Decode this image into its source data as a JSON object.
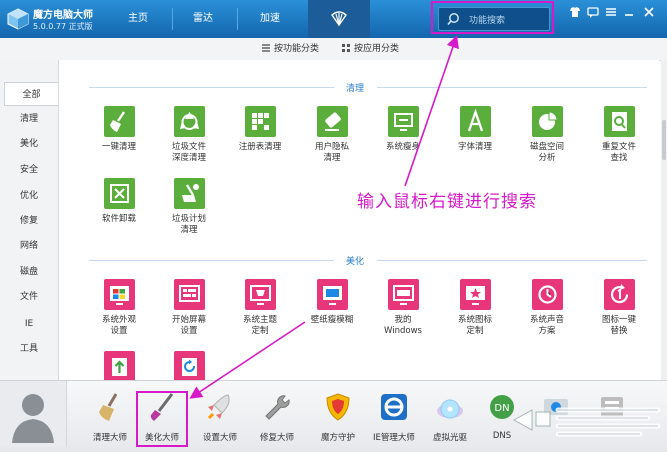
{
  "app": {
    "name": "魔方电脑大师",
    "version": "5.0.0.77 正式版"
  },
  "nav": {
    "tabs": [
      {
        "label": "主页"
      },
      {
        "label": "雷达"
      },
      {
        "label": "加速"
      }
    ]
  },
  "search": {
    "placeholder": "功能搜索"
  },
  "subnav": {
    "tabs": [
      {
        "label": "按功能分类",
        "active": true
      },
      {
        "label": "按应用分类",
        "active": false
      }
    ]
  },
  "sidebar": {
    "items": [
      {
        "label": "全部",
        "active": true
      },
      {
        "label": "清理"
      },
      {
        "label": "美化"
      },
      {
        "label": "安全"
      },
      {
        "label": "优化"
      },
      {
        "label": "修复"
      },
      {
        "label": "网络"
      },
      {
        "label": "磁盘"
      },
      {
        "label": "文件"
      },
      {
        "label": "IE"
      },
      {
        "label": "工具"
      }
    ]
  },
  "sections": [
    {
      "title": "清理",
      "items": [
        {
          "label": "一键清理",
          "icon": "broom-icon"
        },
        {
          "label": "垃圾文件\n深度清理",
          "icon": "recycle-icon"
        },
        {
          "label": "注册表清理",
          "icon": "registry-grid-icon"
        },
        {
          "label": "用户隐私\n清理",
          "icon": "privacy-eraser-icon"
        },
        {
          "label": "系统瘦身",
          "icon": "monitor-slim-icon"
        },
        {
          "label": "字体清理",
          "icon": "font-a-icon"
        },
        {
          "label": "磁盘空间\n分析",
          "icon": "pie-disk-icon"
        },
        {
          "label": "重复文件\n查找",
          "icon": "file-search-icon"
        },
        {
          "label": "软件卸载",
          "icon": "uninstall-box-icon"
        },
        {
          "label": "垃圾计划\n清理",
          "icon": "scheduled-broom-icon"
        }
      ]
    },
    {
      "title": "美化",
      "items": [
        {
          "label": "系统外观\n设置",
          "icon": "windows-logo-icon"
        },
        {
          "label": "开始屏幕\n设置",
          "icon": "start-screen-icon"
        },
        {
          "label": "系统主题\n定制",
          "icon": "theme-monitor-icon"
        },
        {
          "label": "壁纸瘦模糊",
          "icon": "wallpaper-icon"
        },
        {
          "label": "我的\nWindows",
          "icon": "oem-badge-icon"
        },
        {
          "label": "系统图标\n定制",
          "icon": "star-monitor-icon"
        },
        {
          "label": "系统声音\n方案",
          "icon": "sound-clock-icon"
        },
        {
          "label": "图标一键\n替换",
          "icon": "refresh-one-icon"
        },
        {
          "label": "",
          "icon": "upload-arrow-icon"
        },
        {
          "label": "",
          "icon": "refresh-icon"
        }
      ]
    }
  ],
  "toolbar": {
    "items": [
      {
        "label": "清理大师",
        "icon": "brush-icon"
      },
      {
        "label": "美化大师",
        "icon": "paint-brush-icon"
      },
      {
        "label": "设置大师",
        "icon": "rocket-icon"
      },
      {
        "label": "修复大师",
        "icon": "wrench-icon"
      },
      {
        "label": "魔方守护",
        "icon": "shield-icon"
      },
      {
        "label": "IE管理大师",
        "icon": "ie-icon"
      },
      {
        "label": "虚拟光驱",
        "icon": "disc-icon"
      },
      {
        "label": "DNS",
        "icon": "dns-icon"
      },
      {
        "label": "",
        "icon": "partition-icon"
      },
      {
        "label": "",
        "icon": "file-manager-icon"
      }
    ]
  },
  "annotation": {
    "text": "输入鼠标右键进行搜索"
  },
  "colors": {
    "accent": "#1e7ac8",
    "clean_tile": "#5bae3c",
    "beautify_tile": "#e8367a",
    "highlight": "#d619c9"
  }
}
